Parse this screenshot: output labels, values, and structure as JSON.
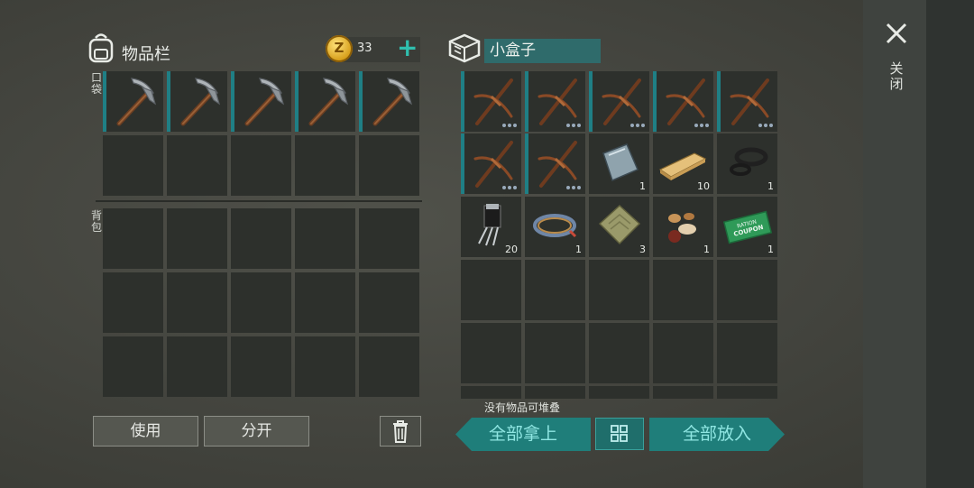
{
  "inventory": {
    "title": "物品栏",
    "coins": "33",
    "pocket_label": "口袋",
    "backpack_label": "背包",
    "pocket_slots": [
      {
        "item": "pickaxe-icon"
      },
      {
        "item": "pickaxe-icon"
      },
      {
        "item": "pickaxe-icon"
      },
      {
        "item": "pickaxe-icon"
      },
      {
        "item": "pickaxe-icon"
      }
    ]
  },
  "container": {
    "name": "小盒子",
    "slots": [
      {
        "item": "bow-drill-icon",
        "durability": true
      },
      {
        "item": "bow-drill-icon",
        "durability": true
      },
      {
        "item": "bow-drill-icon",
        "durability": true
      },
      {
        "item": "bow-drill-icon",
        "durability": true
      },
      {
        "item": "bow-drill-icon",
        "durability": true
      },
      {
        "item": "bow-drill-icon",
        "durability": true
      },
      {
        "item": "bow-drill-icon",
        "durability": true
      },
      {
        "item": "metal-plate-icon",
        "count": "1"
      },
      {
        "item": "wood-plank-icon",
        "count": "10"
      },
      {
        "item": "rubber-ring-icon",
        "count": "1"
      },
      {
        "item": "transistor-icon",
        "count": "20"
      },
      {
        "item": "wire-coil-icon",
        "count": "1"
      },
      {
        "item": "cloth-icon",
        "count": "3"
      },
      {
        "item": "seeds-icon",
        "count": "1"
      },
      {
        "item": "ration-coupon-icon",
        "count": "1",
        "text": [
          "RATION",
          "COUPON"
        ]
      }
    ]
  },
  "actions": {
    "use": "使用",
    "split": "分开",
    "no_stack_hint": "没有物品可堆叠",
    "take_all": "全部拿上",
    "put_all": "全部放入",
    "close": "关闭"
  },
  "colors": {
    "accent": "#1f7e7a",
    "slot": "#2d302c",
    "pocket_marker": "#1f7f85"
  }
}
